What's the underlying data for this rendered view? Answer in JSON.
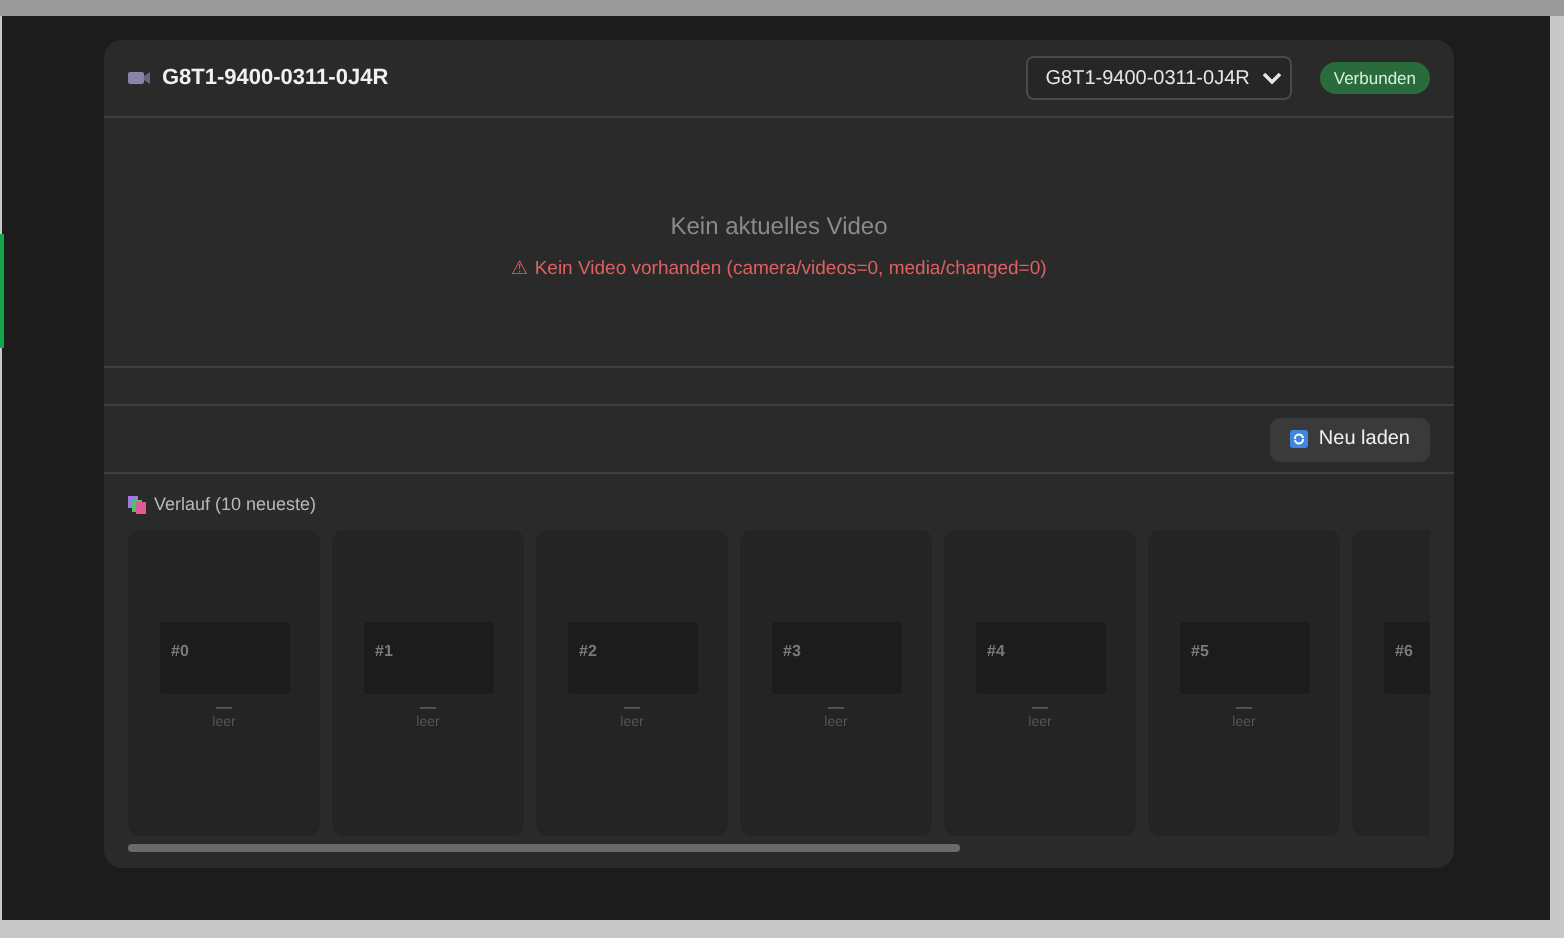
{
  "header": {
    "title": "G8T1-9400-0311-0J4R",
    "device_select": {
      "value": "G8T1-9400-0311-0J4R"
    },
    "status_badge": "Verbunden"
  },
  "video": {
    "placeholder_title": "Kein aktuelles Video",
    "error": "⚠ Kein Video vorhanden (camera/videos=0, media/changed=0)"
  },
  "toolbar": {
    "reload_button": "Neu laden"
  },
  "history": {
    "title": "Verlauf (10 neueste)",
    "items": [
      {
        "label": "#0",
        "value": "—",
        "status": "leer"
      },
      {
        "label": "#1",
        "value": "—",
        "status": "leer"
      },
      {
        "label": "#2",
        "value": "—",
        "status": "leer"
      },
      {
        "label": "#3",
        "value": "—",
        "status": "leer"
      },
      {
        "label": "#4",
        "value": "—",
        "status": "leer"
      },
      {
        "label": "#5",
        "value": "—",
        "status": "leer"
      },
      {
        "label": "#6"
      }
    ]
  }
}
